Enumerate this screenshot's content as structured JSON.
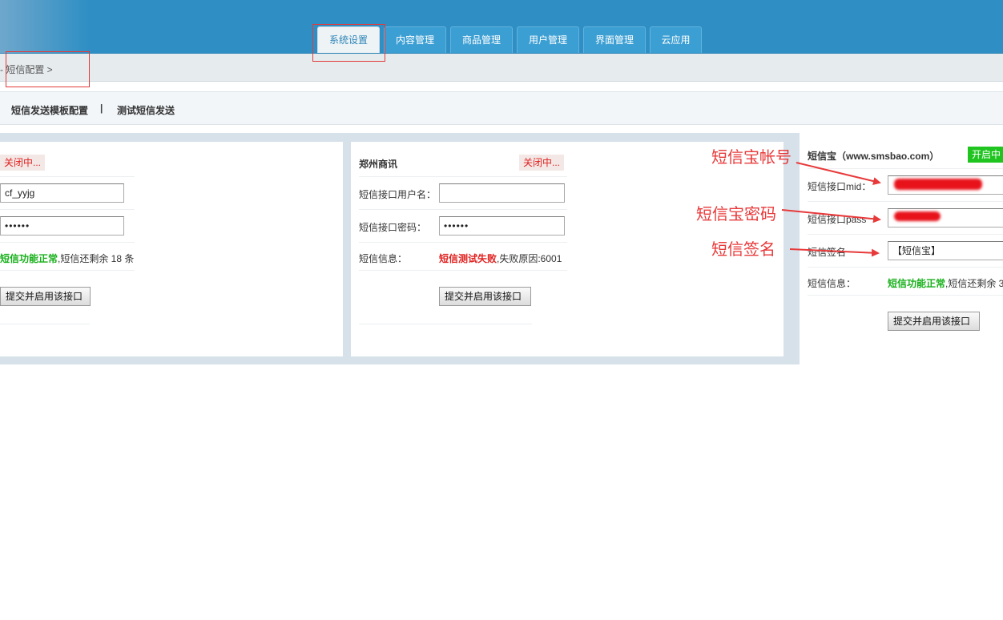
{
  "nav": {
    "tabs": [
      "系统设置",
      "内容管理",
      "商品管理",
      "用户管理",
      "界面管理",
      "云应用"
    ],
    "active_tab": "系统设置"
  },
  "breadcrumb": "- 短信配置 >",
  "subnav": {
    "link1": "短信发送模板配置",
    "separator": "|",
    "link2": "测试短信发送"
  },
  "card1": {
    "status": "关闭中...",
    "username_value": "cf_yyjg",
    "password_value": "••••••",
    "info_ok": "短信功能正常",
    "info_rest": ",短信还剩余 18 条",
    "button": "提交并启用该接口"
  },
  "card2": {
    "title": "郑州商讯",
    "status": "关闭中...",
    "username_label": "短信接口用户名：",
    "username_value": "",
    "password_label": "短信接口密码：",
    "password_value": "••••••",
    "info_label": "短信信息：",
    "info_fail": "短信测试失败",
    "info_rest": ",失败原因:6001",
    "button": "提交并启用该接口"
  },
  "card3": {
    "title": "短信宝（www.smsbao.com）",
    "status": "开启中",
    "mid_label": "短信接口mid：",
    "pass_label": "短信接口pass",
    "sign_label": "短信签名",
    "sign_value": "【短信宝】",
    "info_label": "短信信息：",
    "info_ok": "短信功能正常",
    "info_rest": ",短信还剩余 3",
    "button": "提交并启用该接口"
  },
  "annotations": {
    "account": "短信宝帐号",
    "password": "短信宝密码",
    "signature": "短信签名"
  },
  "colors": {
    "header": "#2f8fc4",
    "annotation": "#e8393a",
    "ok": "#17b01a",
    "fail": "#e0211f",
    "badge_on": "#1fc41f"
  }
}
